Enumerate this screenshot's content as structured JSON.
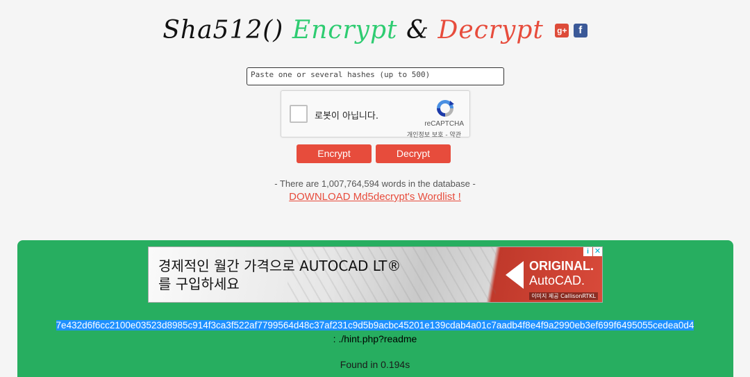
{
  "header": {
    "title_part1": "Sha512()",
    "title_part2": "Encrypt",
    "title_part3": "&",
    "title_part4": "Decrypt",
    "social": [
      {
        "icon": "google-plus-icon",
        "glyph": "g+"
      },
      {
        "icon": "facebook-icon",
        "glyph": "f"
      }
    ]
  },
  "form": {
    "hash_placeholder": "Paste one or several hashes (up to 500)",
    "captcha_label": "로봇이 아닙니다.",
    "captcha_brand": "reCAPTCHA",
    "captcha_links": "개인정보 보호 - 약관",
    "encrypt_label": "Encrypt",
    "decrypt_label": "Decrypt"
  },
  "info": {
    "db_count_text": "- There are 1,007,764,594 words in the database -",
    "download_text": "DOWNLOAD Md5decrypt's Wordlist !"
  },
  "ad": {
    "line1": "경제적인 월간 가격으로 AUTOCAD LT®",
    "line2": "를 구입하세요",
    "badge_line1": "ORIGINAL.",
    "badge_line2": "AutoCAD.",
    "credit": "이미지 제공 CallisonRTKL",
    "info_glyph": "i",
    "close_glyph": "✕"
  },
  "result": {
    "hash": "7e432d6f6cc2100e03523d8985c914f3ca3f522af7799564d48c37af231c9d5b9acbc45201e139cdab4a01c7aadb4f8e4f9a2990eb3ef699f6495055cedea0d4",
    "decoded": ": ./hint.php?readme",
    "found_time": "Found in 0.194s"
  },
  "colors": {
    "green": "#2ecc71",
    "red": "#e74c3c",
    "panel": "#27ae60",
    "highlight": "#1e90ff"
  }
}
